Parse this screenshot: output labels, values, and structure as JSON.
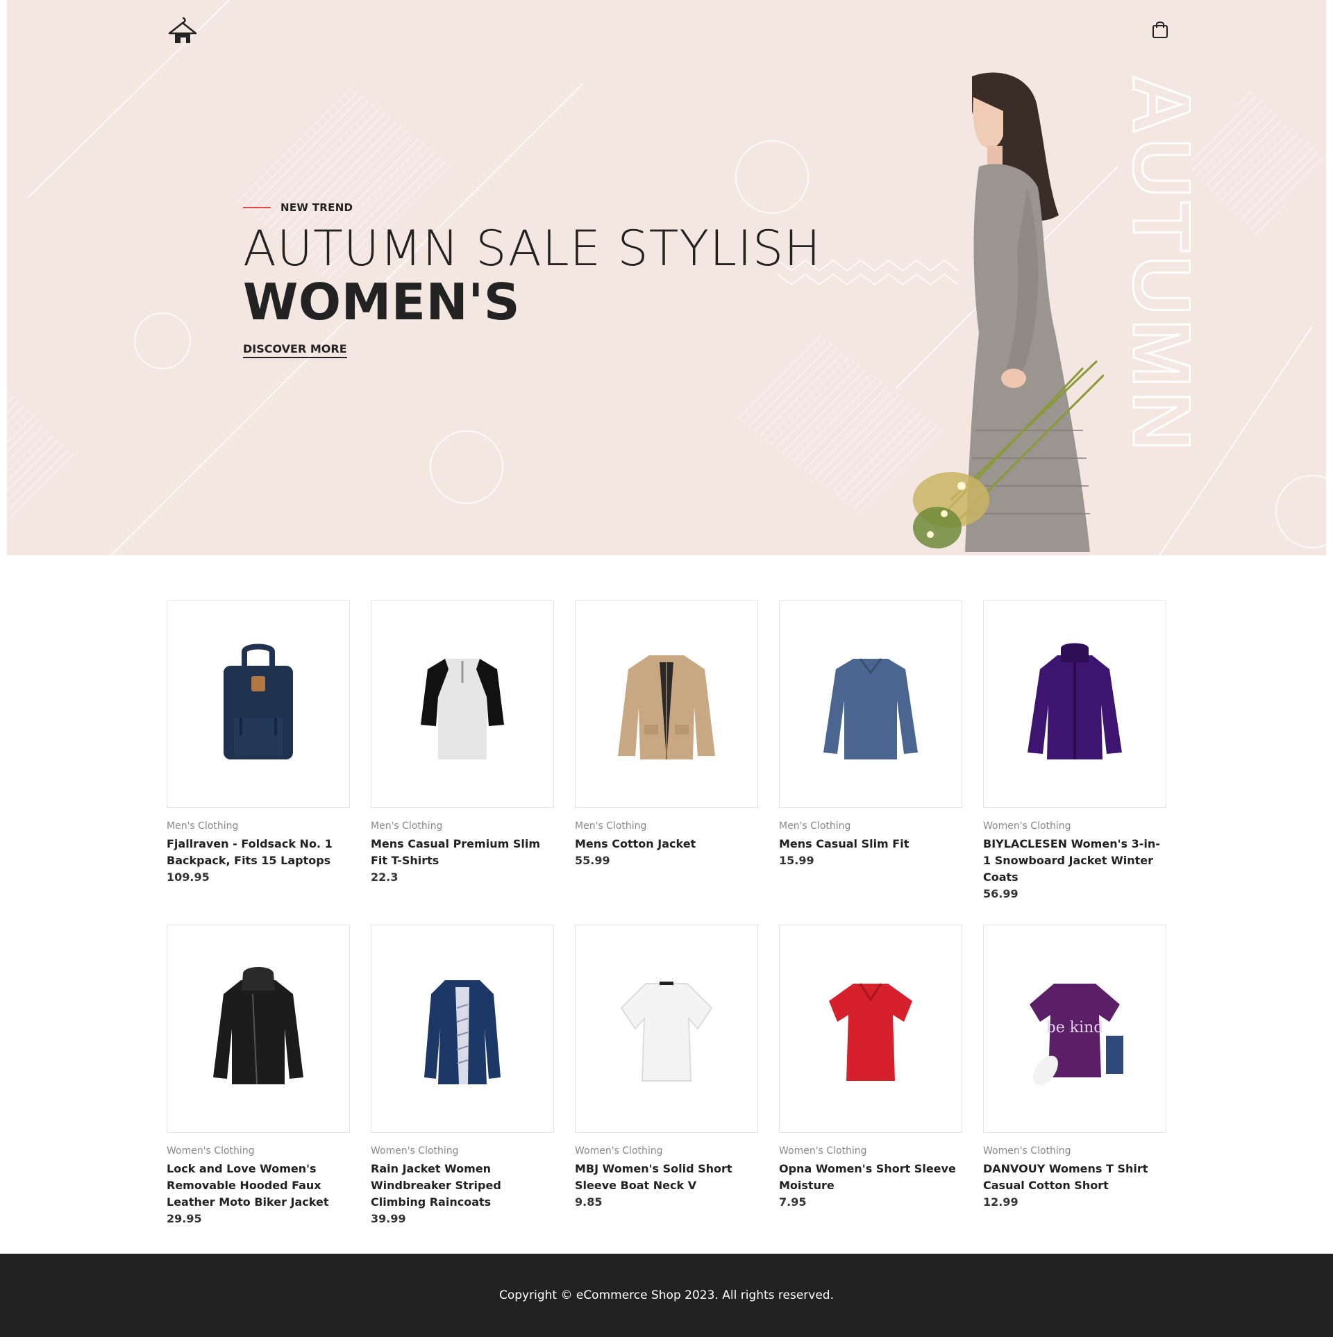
{
  "hero": {
    "eyebrow": "NEW TREND",
    "headline_light": "AUTUMN SALE STYLISH",
    "headline_bold": "WOMEN'S",
    "cta": "DISCOVER MORE",
    "vertical_word": "AUTUMN",
    "bg_color": "#f4e6e0",
    "accent_color": "#e04848"
  },
  "header": {
    "logo_icon": "hanger-logo-icon",
    "cart_icon": "shopping-bag-icon"
  },
  "products": [
    {
      "category": "Men's Clothing",
      "title": "Fjallraven - Foldsack No. 1 Backpack, Fits 15 Laptops",
      "price": "109.95",
      "icon": "backpack"
    },
    {
      "category": "Men's Clothing",
      "title": "Mens Casual Premium Slim Fit T-Shirts",
      "price": "22.3",
      "icon": "raglan-tshirt"
    },
    {
      "category": "Men's Clothing",
      "title": "Mens Cotton Jacket",
      "price": "55.99",
      "icon": "cotton-jacket"
    },
    {
      "category": "Men's Clothing",
      "title": "Mens Casual Slim Fit",
      "price": "15.99",
      "icon": "longsleeve-shirt"
    },
    {
      "category": "Women's Clothing",
      "title": "BIYLACLESEN Women's 3-in-1 Snowboard Jacket Winter Coats",
      "price": "56.99",
      "icon": "snowboard-jacket"
    },
    {
      "category": "Women's Clothing",
      "title": "Lock and Love Women's Removable Hooded Faux Leather Moto Biker Jacket",
      "price": "29.95",
      "icon": "leather-jacket"
    },
    {
      "category": "Women's Clothing",
      "title": "Rain Jacket Women Windbreaker Striped Climbing Raincoats",
      "price": "39.99",
      "icon": "rain-jacket"
    },
    {
      "category": "Women's Clothing",
      "title": "MBJ Women's Solid Short Sleeve Boat Neck V",
      "price": "9.85",
      "icon": "white-top"
    },
    {
      "category": "Women's Clothing",
      "title": "Opna Women's Short Sleeve Moisture",
      "price": "7.95",
      "icon": "red-tshirt"
    },
    {
      "category": "Women's Clothing",
      "title": "DANVOUY Womens T Shirt Casual Cotton Short",
      "price": "12.99",
      "icon": "purple-tshirt"
    }
  ],
  "footer": {
    "copyright": "Copyright © eCommerce Shop 2023. All rights reserved."
  }
}
